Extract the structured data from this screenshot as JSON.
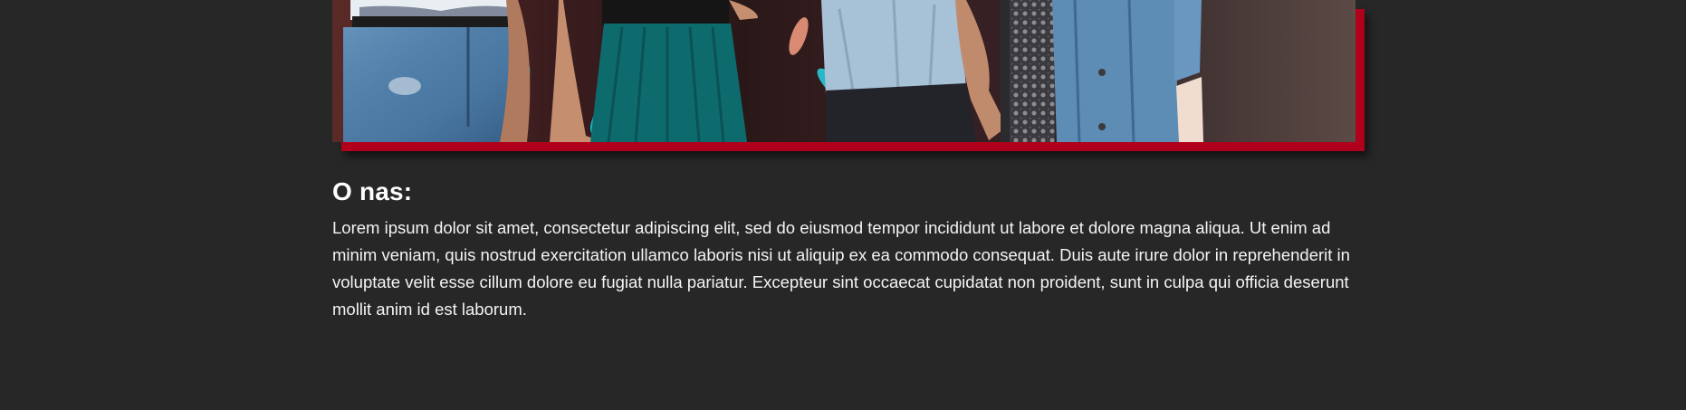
{
  "hero": {
    "image_alt": "Group of people standing together wearing casual clothes",
    "accent_color": "#b0001b"
  },
  "about": {
    "title": "O nas:",
    "text": "Lorem ipsum dolor sit amet, consectetur adipiscing elit, sed do eiusmod tempor incididunt ut labore et dolore magna aliqua. Ut enim ad minim veniam, quis nostrud exercitation ullamco laboris nisi ut aliquip ex ea commodo consequat. Duis aute irure dolor in reprehenderit in voluptate velit esse cillum dolore eu fugiat nulla pariatur. Excepteur sint occaecat cupidatat non proident, sunt in culpa qui officia deserunt mollit anim id est laborum."
  },
  "colors": {
    "background": "#272727",
    "text": "#f4f4f4",
    "accent": "#b0001b"
  }
}
